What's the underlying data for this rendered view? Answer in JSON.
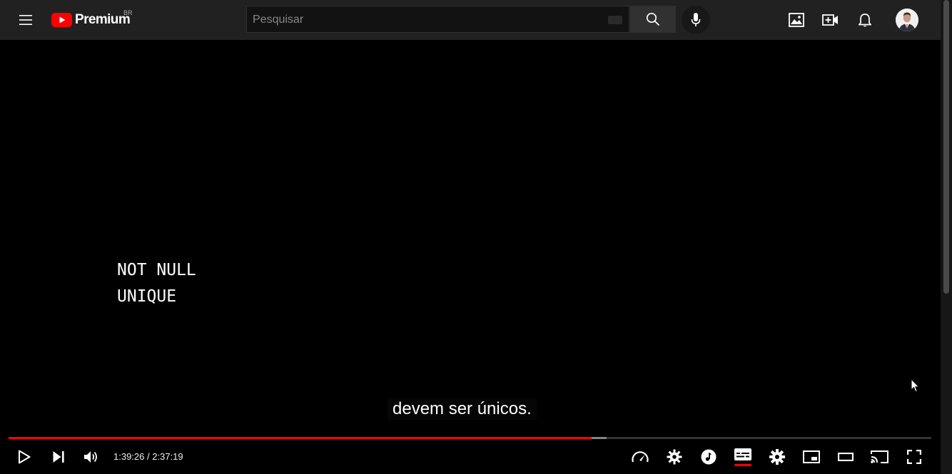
{
  "header": {
    "logo_text": "Premium",
    "logo_country": "BR",
    "search": {
      "placeholder": "Pesquisar",
      "value": ""
    },
    "brand_color": "#FF0000",
    "icons": [
      "menu-icon",
      "youtube-logo-icon",
      "keyboard-icon",
      "search-icon",
      "microphone-icon",
      "image-icon",
      "create-video-icon",
      "bell-icon",
      "avatar"
    ]
  },
  "video": {
    "text_lines": [
      "NOT NULL",
      "UNIQUE"
    ],
    "caption": "devem ser únicos."
  },
  "player": {
    "current_time": "1:39:26",
    "duration": "2:37:19",
    "time_display": "1:39:26 / 2:37:19",
    "played_fraction": 0.632,
    "loaded_fraction": 0.648,
    "progress_color": "#FF0000",
    "subtitles_active": true,
    "left_controls": [
      "play-icon",
      "next-icon",
      "volume-icon"
    ],
    "right_controls": [
      "playback-speed-icon",
      "quality-gear-icon",
      "music-icon",
      "subtitles-icon",
      "settings-icon",
      "miniplayer-icon",
      "theater-mode-icon",
      "cast-icon",
      "fullscreen-icon"
    ]
  }
}
